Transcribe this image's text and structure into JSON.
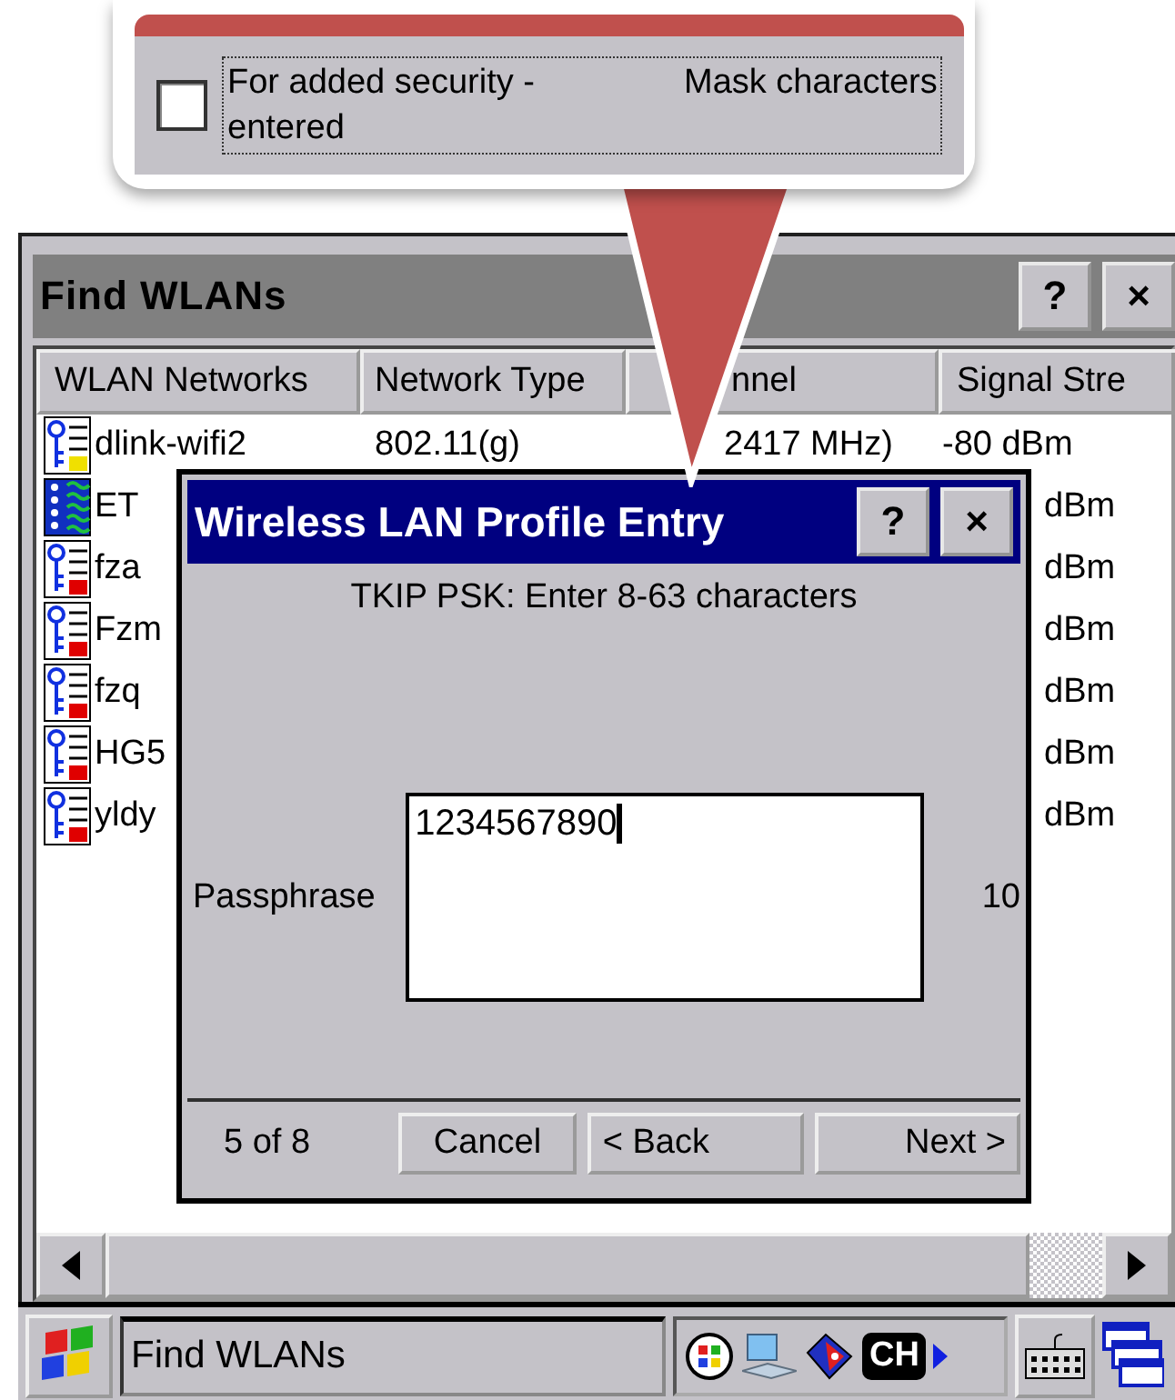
{
  "callout": {
    "checkbox": {
      "label": "For added security - entered",
      "checked": false,
      "focused": true
    },
    "extra_text": "Mask characters"
  },
  "window": {
    "title": "Find WLANs",
    "buttons": [
      "?",
      "×"
    ]
  },
  "columns": [
    "WLAN Networks",
    "Network Type",
    "nnel",
    "Signal Stre"
  ],
  "rows": [
    {
      "kind": "secured",
      "color": "#f0e000",
      "name": "dlink-wifi2",
      "type": "802.11(g)",
      "channel": "2417 MHz)",
      "signal": "-80 dBm"
    },
    {
      "kind": "adhoc",
      "name": "ET",
      "signal": "dBm"
    },
    {
      "kind": "secured",
      "color": "#e00000",
      "name": "fza",
      "signal": "dBm"
    },
    {
      "kind": "secured",
      "color": "#e00000",
      "name": "Fzm",
      "signal": "dBm"
    },
    {
      "kind": "secured",
      "color": "#e00000",
      "name": "fzq",
      "signal": "dBm"
    },
    {
      "kind": "secured",
      "color": "#e00000",
      "name": "HG5",
      "signal": "dBm"
    },
    {
      "kind": "secured",
      "color": "#e00000",
      "name": "yldy",
      "signal": "dBm"
    }
  ],
  "dialog": {
    "title": "Wireless LAN Profile Entry",
    "buttons": [
      "?",
      "×"
    ],
    "prompt": "TKIP PSK: Enter 8-63 characters",
    "field_label": "Passphrase",
    "value": "1234567890",
    "count": "10",
    "step": "5 of 8",
    "actions": [
      "Cancel",
      "< Back",
      "Next >"
    ]
  },
  "taskbar": {
    "task": "Find WLANs",
    "input_indicator": "CH"
  }
}
